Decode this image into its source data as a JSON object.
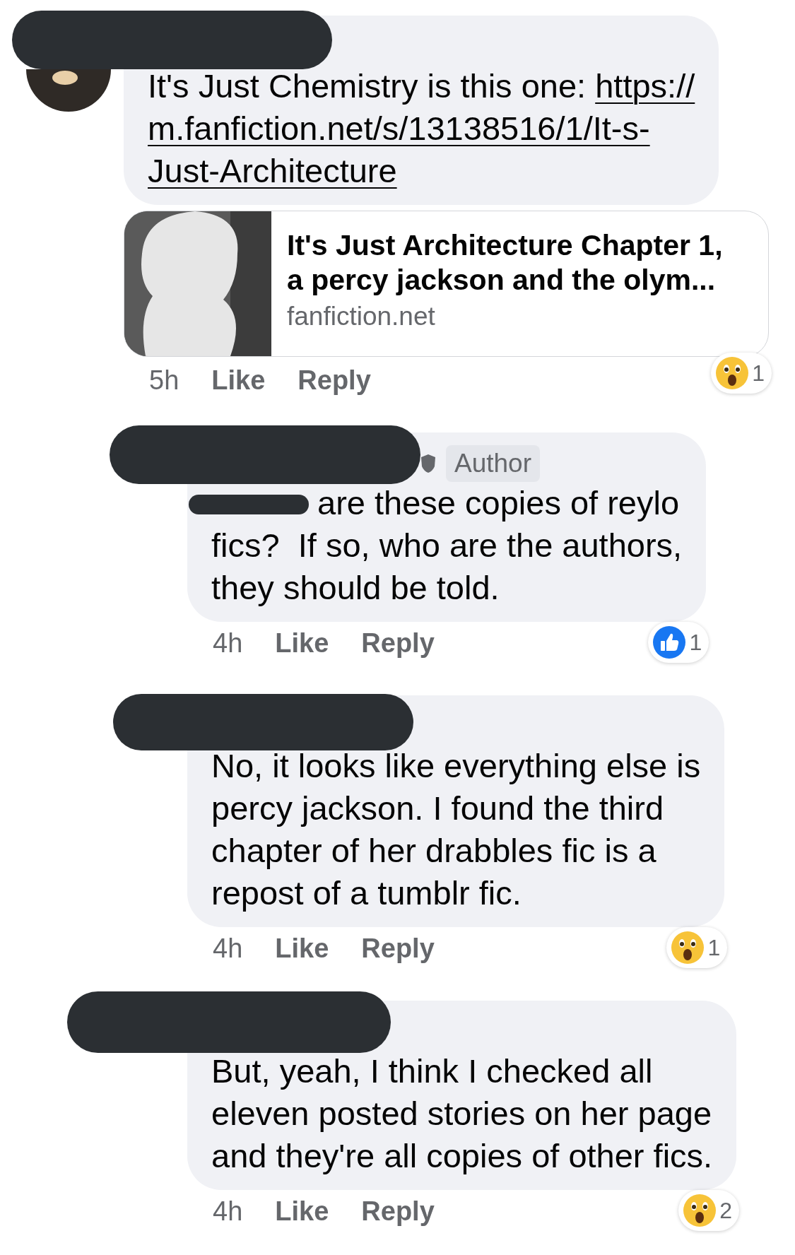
{
  "comments": [
    {
      "kind": "comment",
      "text": "It's Just Chemistry is this one: ",
      "link_lines": [
        "https://",
        "m.fanfiction.net/s/13138516/1/It-s-",
        "Just-Architecture"
      ],
      "preview": {
        "title_lines": [
          "It's Just Architecture Chapter 1,",
          "a percy jackson and the olym..."
        ],
        "domain": "fanfiction.net"
      },
      "time": "5h",
      "like": "Like",
      "reply": "Reply",
      "reaction": {
        "kind": "wow",
        "count": "1"
      }
    },
    {
      "kind": "reply",
      "author_badge": "Author",
      "redacted_prefix": true,
      "text_lines": [
        "are these copies of reylo",
        "fics?  If so, who are the authors,",
        "they should be told."
      ],
      "time": "4h",
      "like": "Like",
      "reply": "Reply",
      "reaction": {
        "kind": "like",
        "count": "1"
      }
    },
    {
      "kind": "reply",
      "text_lines": [
        "No, it looks like everything else is",
        "percy jackson. I found the third",
        "chapter of her drabbles fic is a",
        "repost of a tumblr fic."
      ],
      "time": "4h",
      "like": "Like",
      "reply": "Reply",
      "reaction": {
        "kind": "wow",
        "count": "1"
      }
    },
    {
      "kind": "reply",
      "text_lines": [
        "But, yeah, I think I checked all",
        "eleven posted stories on her page",
        "and they're all copies of other fics."
      ],
      "time": "4h",
      "like": "Like",
      "reply": "Reply",
      "reaction": {
        "kind": "wow",
        "count": "2"
      }
    }
  ]
}
